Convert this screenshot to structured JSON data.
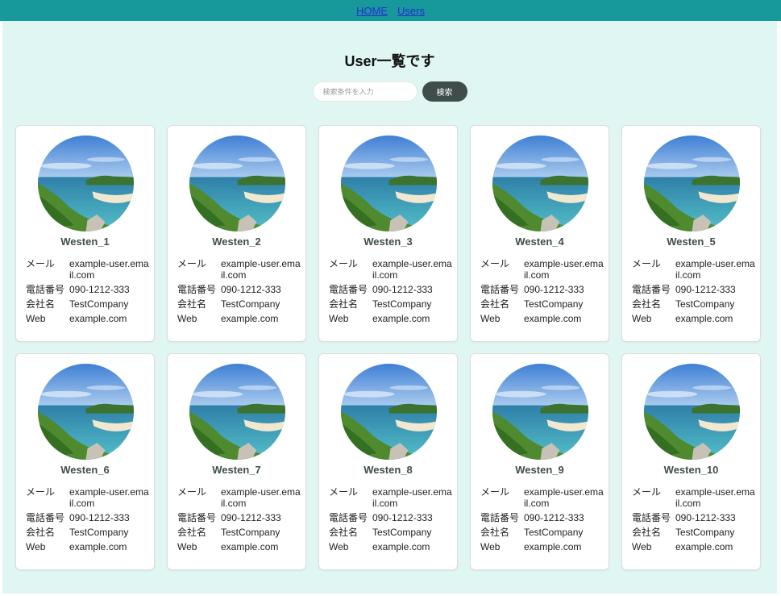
{
  "nav": {
    "home_label": "HOME",
    "users_label": "Users"
  },
  "page": {
    "title": "User一覧です"
  },
  "search": {
    "placeholder": "検索条件を入力",
    "button_label": "検索"
  },
  "labels": {
    "email": "メール",
    "phone": "電話番号",
    "company": "会社名",
    "web": "Web"
  },
  "users": [
    {
      "name": "Westen_1",
      "email": "example-user.email.com",
      "phone": "090-1212-333",
      "company": "TestCompany",
      "web": "example.com"
    },
    {
      "name": "Westen_2",
      "email": "example-user.email.com",
      "phone": "090-1212-333",
      "company": "TestCompany",
      "web": "example.com"
    },
    {
      "name": "Westen_3",
      "email": "example-user.email.com",
      "phone": "090-1212-333",
      "company": "TestCompany",
      "web": "example.com"
    },
    {
      "name": "Westen_4",
      "email": "example-user.email.com",
      "phone": "090-1212-333",
      "company": "TestCompany",
      "web": "example.com"
    },
    {
      "name": "Westen_5",
      "email": "example-user.email.com",
      "phone": "090-1212-333",
      "company": "TestCompany",
      "web": "example.com"
    },
    {
      "name": "Westen_6",
      "email": "example-user.email.com",
      "phone": "090-1212-333",
      "company": "TestCompany",
      "web": "example.com"
    },
    {
      "name": "Westen_7",
      "email": "example-user.email.com",
      "phone": "090-1212-333",
      "company": "TestCompany",
      "web": "example.com"
    },
    {
      "name": "Westen_8",
      "email": "example-user.email.com",
      "phone": "090-1212-333",
      "company": "TestCompany",
      "web": "example.com"
    },
    {
      "name": "Westen_9",
      "email": "example-user.email.com",
      "phone": "090-1212-333",
      "company": "TestCompany",
      "web": "example.com"
    },
    {
      "name": "Westen_10",
      "email": "example-user.email.com",
      "phone": "090-1212-333",
      "company": "TestCompany",
      "web": "example.com"
    }
  ],
  "colors": {
    "header": "#17989a",
    "background": "#e0f6f2",
    "accent": "#3f4e4a",
    "link": "#2b2bd6"
  }
}
